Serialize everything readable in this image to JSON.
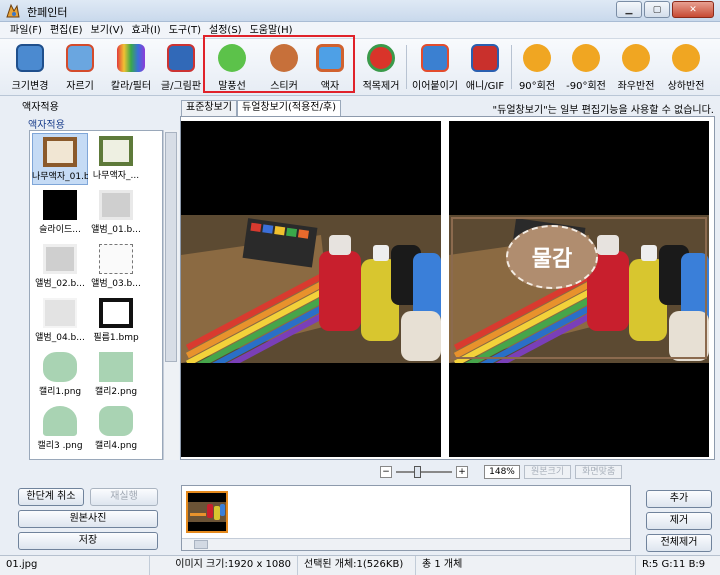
{
  "window": {
    "title": "한페인터"
  },
  "menu": [
    "파일(F)",
    "편집(E)",
    "보기(V)",
    "효과(I)",
    "도구(T)",
    "설정(S)",
    "도움말(H)"
  ],
  "toolbar": {
    "items": [
      {
        "label": "크기변경",
        "icon": "resize-icon"
      },
      {
        "label": "자르기",
        "icon": "crop-icon"
      },
      {
        "label": "칼라/필터",
        "icon": "color-filter-icon"
      },
      {
        "label": "글/그림판",
        "icon": "text-draw-icon"
      },
      {
        "label": "말풍선",
        "icon": "speech-bubble-icon"
      },
      {
        "label": "스티커",
        "icon": "sticker-icon"
      },
      {
        "label": "액자",
        "icon": "frame-icon"
      },
      {
        "label": "적목제거",
        "icon": "red-eye-icon"
      },
      {
        "label": "이어붙이기",
        "icon": "merge-icon"
      },
      {
        "label": "애니/GIF",
        "icon": "gif-icon"
      },
      {
        "label": "90°회전",
        "icon": "rotate-cw-icon"
      },
      {
        "label": "-90°회전",
        "icon": "rotate-ccw-icon"
      },
      {
        "label": "좌우반전",
        "icon": "flip-horizontal-icon"
      },
      {
        "label": "상하반전",
        "icon": "flip-vertical-icon"
      }
    ]
  },
  "left_panel": {
    "title": "액자적용",
    "group": "액자적용",
    "items": [
      {
        "label": "나무액자_01.bmp",
        "selected": true
      },
      {
        "label": "나무액자_..."
      },
      {
        "label": "슬라이드..."
      },
      {
        "label": "앨범_01.b..."
      },
      {
        "label": "앨범_02.b..."
      },
      {
        "label": "앨범_03.b..."
      },
      {
        "label": "앨범_04.b..."
      },
      {
        "label": "필름1.bmp"
      },
      {
        "label": "캘리1.png"
      },
      {
        "label": "캘리2.png"
      },
      {
        "label": "캘리3 .png"
      },
      {
        "label": "캘리4.png"
      }
    ]
  },
  "view": {
    "tabs": [
      "표준창보기",
      "듀얼창보기(적용전/후)"
    ],
    "active_tab": 1,
    "notice": "\"듀얼창보기\"는 일부 편집기능을 사용할 수 없습니다.",
    "sticker_text": "물감"
  },
  "zoom": {
    "minus": "−",
    "plus": "+",
    "value": "148%",
    "original_size_label": "원본크기",
    "fit_label": "화면맞춤"
  },
  "actions": {
    "undo": "한단계 취소",
    "redo": "재실행",
    "original": "원본사진",
    "save": "저장",
    "add": "추가",
    "remove": "제거",
    "remove_all": "전체제거"
  },
  "status": {
    "file": "01.jpg",
    "image_size": "이미지 크기:1920 x 1080",
    "selected": "선택된 개체:1(526KB)",
    "total": "총 1 개체",
    "color": "R:5 G:11 B:9"
  }
}
